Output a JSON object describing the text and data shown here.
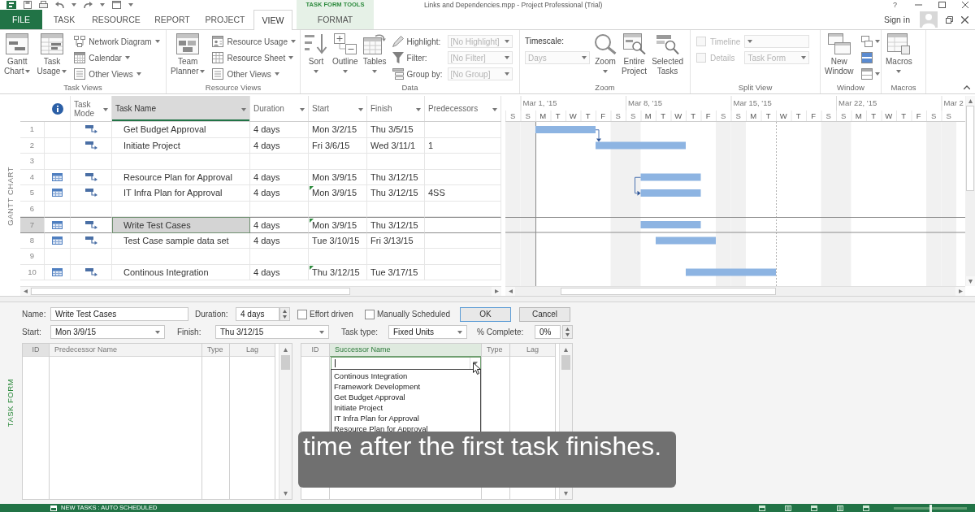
{
  "title_bar": {
    "contextual_label": "TASK FORM TOOLS",
    "title": "Links and Dependencies.mpp - Project Professional (Trial)",
    "help": "?"
  },
  "ribbon_tabs": [
    {
      "label": "FILE",
      "kind": "file",
      "selected": false
    },
    {
      "label": "TASK",
      "kind": "tab",
      "selected": false
    },
    {
      "label": "RESOURCE",
      "kind": "tab",
      "selected": false
    },
    {
      "label": "REPORT",
      "kind": "tab",
      "selected": false
    },
    {
      "label": "PROJECT",
      "kind": "tab",
      "selected": false
    },
    {
      "label": "VIEW",
      "kind": "tab",
      "selected": true
    },
    {
      "label": "FORMAT",
      "kind": "contextual",
      "selected": false
    }
  ],
  "account": {
    "label": "Sign in"
  },
  "ribbon": {
    "groups": [
      {
        "label": "Task Views",
        "items": [
          {
            "kind": "large",
            "label": "Gantt Chart",
            "menu": true
          },
          {
            "kind": "large",
            "label": "Task Usage",
            "menu": true
          },
          {
            "kind": "stack",
            "items": [
              {
                "kind": "button",
                "label": "Network Diagram",
                "menu": true
              },
              {
                "kind": "button",
                "label": "Calendar",
                "menu": true
              },
              {
                "kind": "button",
                "label": "Other Views",
                "menu": true
              }
            ]
          }
        ]
      },
      {
        "label": "Resource Views",
        "items": [
          {
            "kind": "large",
            "label": "Team Planner",
            "menu": true
          },
          {
            "kind": "stack",
            "items": [
              {
                "kind": "button",
                "label": "Resource Usage",
                "menu": true
              },
              {
                "kind": "button",
                "label": "Resource Sheet",
                "menu": true
              },
              {
                "kind": "button",
                "label": "Other Views",
                "menu": true
              }
            ]
          }
        ]
      },
      {
        "label": "Data",
        "items": [
          {
            "kind": "large",
            "label": "Sort",
            "menu": true
          },
          {
            "kind": "large",
            "label": "Outline",
            "menu": true
          },
          {
            "kind": "large",
            "label": "Tables",
            "menu": true
          },
          {
            "kind": "stack",
            "items": [
              {
                "kind": "button",
                "label": "Highlight:",
                "menu": false
              },
              {
                "kind": "button",
                "label": "Filter:",
                "menu": false
              },
              {
                "kind": "button",
                "label": "Group by:",
                "menu": false
              }
            ]
          },
          {
            "kind": "stack",
            "items": [
              {
                "kind": "dropdown",
                "value": "[No Highlight]",
                "disabled": true
              },
              {
                "kind": "dropdown",
                "value": "[No Filter]",
                "disabled": true
              },
              {
                "kind": "dropdown",
                "value": "[No Group]",
                "disabled": true
              }
            ]
          }
        ]
      },
      {
        "label": "Zoom",
        "items": [
          {
            "kind": "stack",
            "items": [
              {
                "kind": "label",
                "label": "Timescale:"
              },
              {
                "kind": "dropdown",
                "value": "Days",
                "disabled": true
              }
            ]
          },
          {
            "kind": "large",
            "label": "Zoom",
            "menu": true
          },
          {
            "kind": "large",
            "label": "Entire Project",
            "menu": false
          },
          {
            "kind": "large",
            "label": "Selected Tasks",
            "menu": false
          }
        ]
      },
      {
        "label": "Split View",
        "items": [
          {
            "kind": "stack",
            "items": [
              {
                "kind": "checkbox",
                "label": "Timeline",
                "checked": false,
                "disabled": true
              },
              {
                "kind": "checkbox",
                "label": "Details",
                "checked": false,
                "disabled": true
              }
            ]
          },
          {
            "kind": "stack",
            "items": [
              {
                "kind": "dropdown",
                "disabled": true
              },
              {
                "kind": "dropdown",
                "value": "Task Form",
                "disabled": true
              }
            ]
          }
        ]
      },
      {
        "label": "Window",
        "items": [
          {
            "kind": "large",
            "label": "New Window",
            "menu": false
          },
          {
            "kind": "stack",
            "items": [
              {
                "kind": "icon",
                "menu": true
              },
              {
                "kind": "icon",
                "menu": false
              },
              {
                "kind": "icon",
                "menu": true
              }
            ]
          }
        ]
      },
      {
        "label": "Macros",
        "items": [
          {
            "kind": "large",
            "label": "Macros",
            "menu": true
          }
        ]
      }
    ]
  },
  "gantt_view": {
    "side_label": "GANTT CHART",
    "table": {
      "columns": [
        {
          "kind": "info"
        },
        {
          "kind": "mode",
          "label": "Task Mode",
          "selected": false
        },
        {
          "kind": "name",
          "label": "Task Name",
          "selected": true
        },
        {
          "kind": "duration",
          "label": "Duration",
          "selected": false
        },
        {
          "kind": "start",
          "label": "Start",
          "selected": false
        },
        {
          "kind": "finish",
          "label": "Finish",
          "selected": false
        },
        {
          "kind": "predecessors",
          "label": "Predecessors",
          "selected": false
        }
      ],
      "rows": [
        {
          "id": "1",
          "kind": "task",
          "indicator": false,
          "manually_scheduled": false,
          "name": "Get Budget Approval",
          "duration": "4 days",
          "start": "Mon 3/2/15",
          "start_flag": false,
          "finish": "Thu 3/5/15",
          "selected": false
        },
        {
          "id": "2",
          "kind": "task",
          "indicator": false,
          "manually_scheduled": false,
          "name": "Initiate Project",
          "duration": "4 days",
          "start": "Fri 3/6/15",
          "start_flag": false,
          "finish": "Wed 3/11/1",
          "predecessors": "1",
          "selected": false
        },
        {
          "id": "3",
          "kind": "blank",
          "selected": false
        },
        {
          "id": "4",
          "kind": "task",
          "indicator": true,
          "manually_scheduled": false,
          "name": "Resource Plan for Approval",
          "duration": "4 days",
          "start": "Mon 3/9/15",
          "start_flag": false,
          "finish": "Thu 3/12/15",
          "selected": false
        },
        {
          "id": "5",
          "kind": "task",
          "indicator": true,
          "manually_scheduled": false,
          "name": "IT Infra Plan for Approval",
          "duration": "4 days",
          "start": "Mon 3/9/15",
          "start_flag": true,
          "finish": "Thu 3/12/15",
          "predecessors": "4SS",
          "selected": false
        },
        {
          "id": "6",
          "kind": "blank",
          "selected": false
        },
        {
          "id": "7",
          "kind": "task",
          "indicator": true,
          "manually_scheduled": false,
          "name": "Write Test Cases",
          "duration": "4 days",
          "start": "Mon 3/9/15",
          "start_flag": true,
          "finish": "Thu 3/12/15",
          "selected": true
        },
        {
          "id": "8",
          "kind": "task",
          "indicator": true,
          "manually_scheduled": false,
          "name": "Test Case sample data set",
          "duration": "4 days",
          "start": "Tue 3/10/15",
          "start_flag": false,
          "finish": "Fri 3/13/15",
          "selected": false
        },
        {
          "id": "9",
          "kind": "blank",
          "selected": false
        },
        {
          "id": "10",
          "kind": "task",
          "indicator": true,
          "manually_scheduled": false,
          "name": "Continous Integration",
          "duration": "4 days",
          "start": "Thu 3/12/15",
          "start_flag": true,
          "finish": "Tue 3/17/15",
          "selected": false
        }
      ]
    },
    "chart": {
      "weeks": [
        "Mar 1, '15",
        "Mar 8, '15",
        "Mar 15, '15",
        "Mar 22, '15",
        "Mar 2"
      ],
      "days": [
        {
          "label": "S",
          "nonworking": true
        },
        {
          "label": "S",
          "nonworking": true
        },
        {
          "label": "M",
          "nonworking": false
        },
        {
          "label": "T",
          "nonworking": false
        },
        {
          "label": "W",
          "nonworking": false
        },
        {
          "label": "T",
          "nonworking": false
        },
        {
          "label": "F",
          "nonworking": false
        },
        {
          "label": "S",
          "nonworking": true
        },
        {
          "label": "S",
          "nonworking": true
        },
        {
          "label": "M",
          "nonworking": false
        },
        {
          "label": "T",
          "nonworking": false
        },
        {
          "label": "W",
          "nonworking": false
        },
        {
          "label": "T",
          "nonworking": false
        },
        {
          "label": "F",
          "nonworking": false
        },
        {
          "label": "S",
          "nonworking": true
        },
        {
          "label": "S",
          "nonworking": true
        },
        {
          "label": "M",
          "nonworking": false
        },
        {
          "label": "T",
          "nonworking": false
        },
        {
          "label": "W",
          "nonworking": false
        },
        {
          "label": "T",
          "nonworking": false
        },
        {
          "label": "F",
          "nonworking": false
        },
        {
          "label": "S",
          "nonworking": true
        },
        {
          "label": "S",
          "nonworking": true
        },
        {
          "label": "M",
          "nonworking": false
        },
        {
          "label": "T",
          "nonworking": false
        },
        {
          "label": "W",
          "nonworking": false
        },
        {
          "label": "T",
          "nonworking": false
        },
        {
          "label": "F",
          "nonworking": false
        },
        {
          "label": "S",
          "nonworking": true
        },
        {
          "label": "S",
          "nonworking": true
        }
      ]
    }
  },
  "task_form": {
    "side_label": "TASK FORM",
    "name": {
      "label": "Name:",
      "value": "Write Test Cases"
    },
    "duration": {
      "label": "Duration:",
      "value": "4 days"
    },
    "effort_driven": {
      "label": "Effort driven",
      "checked": false
    },
    "manually_scheduled": {
      "label": "Manually Scheduled",
      "checked": false
    },
    "buttons": [
      {
        "label": "OK",
        "default": true
      },
      {
        "label": "Cancel",
        "default": false
      }
    ],
    "start": {
      "label": "Start:",
      "value": "Mon 3/9/15"
    },
    "finish": {
      "label": "Finish:",
      "value": "Thu 3/12/15"
    },
    "task_type": {
      "label": "Task type:",
      "value": "Fixed Units"
    },
    "percent_complete": {
      "label": "% Complete:",
      "value": "0%"
    },
    "predecessors": {
      "columns": [
        {
          "label": "ID",
          "selected": false
        },
        {
          "label": "Predecessor Name",
          "selected": false
        },
        {
          "label": "Type",
          "selected": false
        },
        {
          "label": "Lag",
          "selected": false
        }
      ]
    },
    "successors": {
      "columns": [
        {
          "label": "ID",
          "selected": false
        },
        {
          "label": "Successor Name",
          "selected": true
        },
        {
          "label": "Type",
          "selected": false
        },
        {
          "label": "Lag",
          "selected": false
        }
      ],
      "editor": {
        "options": [
          "Continous Integration",
          "Framework Development",
          "Get Budget Approval",
          "Initiate Project",
          "IT Infra Plan for Approval",
          "Resource Plan for Approval"
        ]
      }
    }
  },
  "caption": {
    "text": "time after the first task finishes."
  },
  "status_bar": {
    "text": "NEW TASKS : AUTO SCHEDULED",
    "zoom_slider": {
      "level": 0.5
    }
  }
}
